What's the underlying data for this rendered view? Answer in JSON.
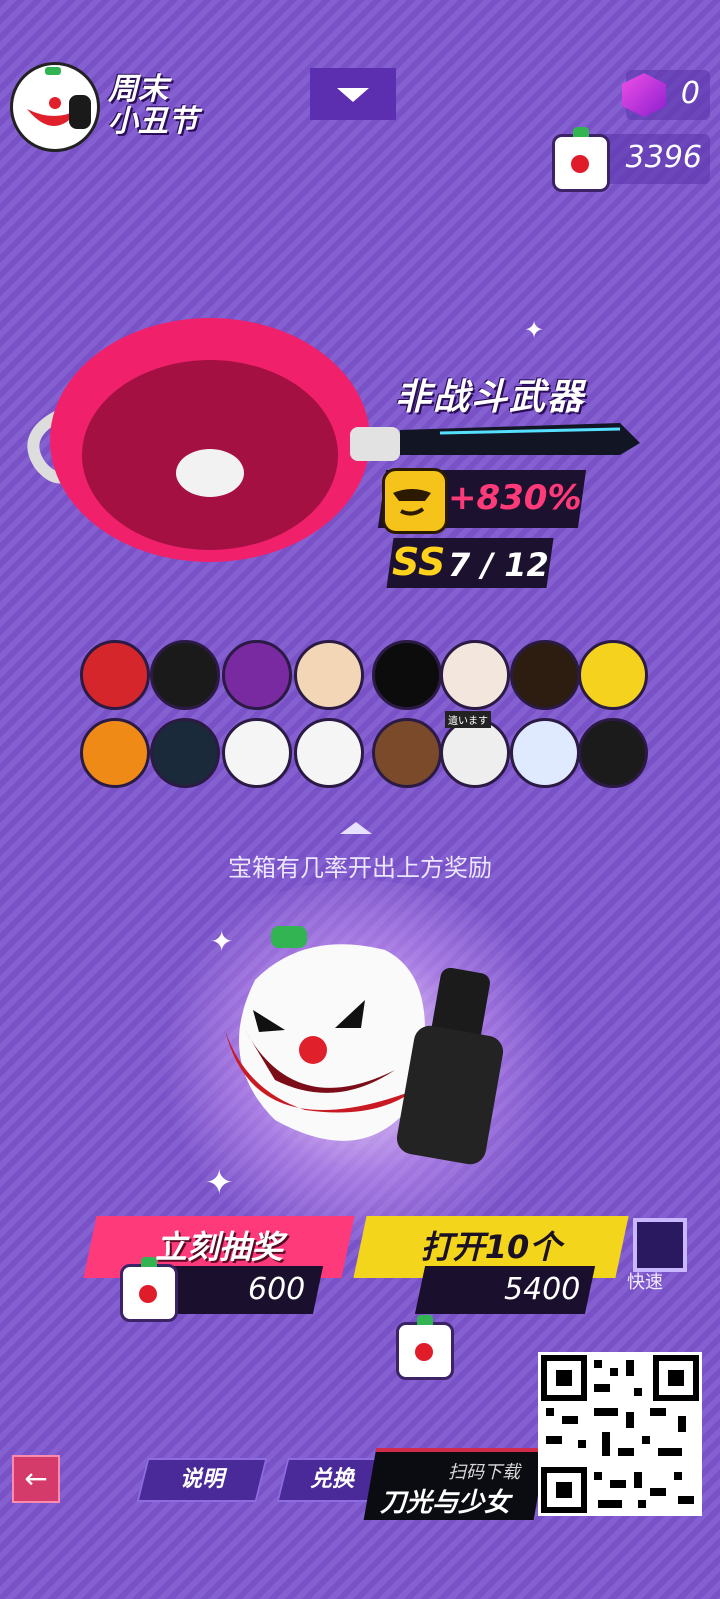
{
  "event": {
    "title": "周末\n小丑节"
  },
  "currency": {
    "gems": "0",
    "boxes": "3396"
  },
  "reward": {
    "weapon_type": "非战斗武器",
    "bonus": "+830%",
    "grade": "SS",
    "count": "7 / 12"
  },
  "reward_items": [
    {
      "icon": "nutcracker-head-icon",
      "color": "#d4262b"
    },
    {
      "icon": "halo-hair-head-icon",
      "color": "#1a1a1a"
    },
    {
      "icon": "armored-helmet-icon",
      "color": "#7a2aa0"
    },
    {
      "icon": "blonde-hair-head-icon",
      "color": "#f2d6b5"
    },
    {
      "icon": "black-blob-head-icon",
      "color": "#0c0c0c"
    },
    {
      "icon": "horned-skull-icon",
      "color": "#f3e6dc"
    },
    {
      "icon": "racing-helmet-icon",
      "color": "#2c1d10"
    },
    {
      "icon": "block-face-icon",
      "color": "#f4d21d"
    },
    {
      "icon": "pumpkin-head-icon",
      "color": "#f08a17"
    },
    {
      "icon": "cyber-helmet-icon",
      "color": "#1a2a3a"
    },
    {
      "icon": "ghost-head-icon",
      "color": "#f5f5f5"
    },
    {
      "icon": "clown-head-icon",
      "color": "#f5f5f5"
    },
    {
      "icon": "bear-head-icon",
      "color": "#7a4a2a"
    },
    {
      "icon": "box-head-icon",
      "color": "#eeeeee"
    },
    {
      "icon": "fish-head-icon",
      "color": "#dfe9ff"
    },
    {
      "icon": "reaper-head-icon",
      "color": "#1b1b1b"
    }
  ],
  "box_tag": "遺います",
  "hint": "宝箱有几率开出上方奖励",
  "actions": {
    "draw_now": "立刻抽奖",
    "draw_now_cost": "600",
    "open_ten": "打开10个",
    "open_ten_cost": "5400",
    "quick": "快速"
  },
  "nav": {
    "info": "说明",
    "exchange": "兑换"
  },
  "ad": {
    "scan_text": "扫码下载",
    "game_name": "刀光与少女"
  },
  "colors": {
    "draw_now": "#ff3a7a",
    "open_ten": "#f3d51c",
    "background": "#7a52c8"
  }
}
